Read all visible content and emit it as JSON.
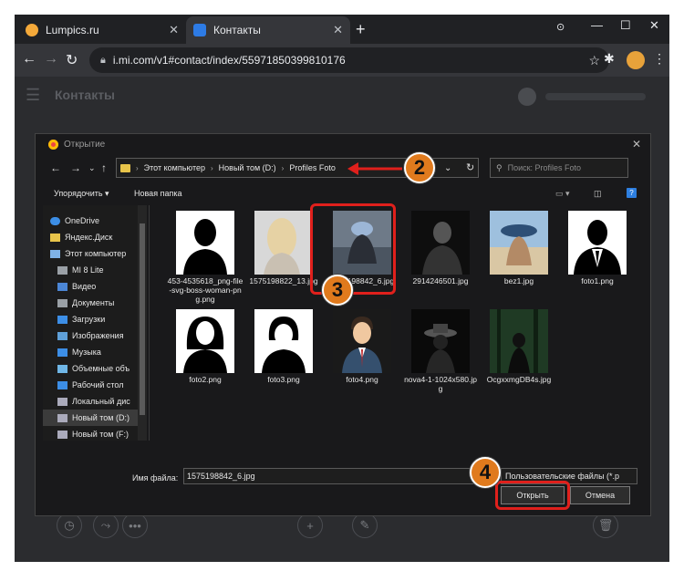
{
  "browser": {
    "tabs": [
      {
        "label": "Lumpics.ru",
        "favicon_color": "#f4a93a"
      },
      {
        "label": "Контакты",
        "favicon_color": "#2d7be5"
      }
    ],
    "url": "i.mi.com/v1#contact/index/55971850399810176"
  },
  "page": {
    "title": "Контакты"
  },
  "dialog": {
    "title": "Открытие",
    "breadcrumb": [
      "Этот компьютер",
      "Новый том (D:)",
      "Profiles Foto"
    ],
    "search_placeholder": "Поиск: Profiles Foto",
    "organize_label": "Упорядочить ▾",
    "new_folder_label": "Новая папка",
    "nav_items": [
      {
        "label": "OneDrive",
        "icon": "cloud-icon",
        "color": "#3c8ee6"
      },
      {
        "label": "Яндекс.Диск",
        "icon": "folder-icon",
        "color": "#e8c44a"
      },
      {
        "label": "Этот компьютер",
        "icon": "computer-icon",
        "color": "#7fb2e6"
      },
      {
        "label": "MI 8 Lite",
        "icon": "phone-icon",
        "color": "#9aa0a6"
      },
      {
        "label": "Видео",
        "icon": "video-icon",
        "color": "#4b86d6"
      },
      {
        "label": "Документы",
        "icon": "documents-icon",
        "color": "#9aa0a6"
      },
      {
        "label": "Загрузки",
        "icon": "download-icon",
        "color": "#3c8ee6"
      },
      {
        "label": "Изображения",
        "icon": "pictures-icon",
        "color": "#5fa0d8"
      },
      {
        "label": "Музыка",
        "icon": "music-icon",
        "color": "#3c8ee6"
      },
      {
        "label": "Объемные объ",
        "icon": "3d-objects-icon",
        "color": "#6fb6e6"
      },
      {
        "label": "Рабочий стол",
        "icon": "desktop-icon",
        "color": "#3c8ee6"
      },
      {
        "label": "Локальный дис",
        "icon": "drive-icon",
        "color": "#aab"
      },
      {
        "label": "Новый том (D:)",
        "icon": "drive-icon",
        "color": "#aab",
        "selected": true
      },
      {
        "label": "Новый том (F:)",
        "icon": "drive-icon",
        "color": "#aab"
      }
    ],
    "files": [
      {
        "name": "453-4535618_png-file-svg-boss-woman-png.png",
        "kind": "silhouette-woman",
        "bg": "#ffffff"
      },
      {
        "name": "1575198822_13.jpg",
        "kind": "photo-blonde",
        "bg": "#cfcfcf"
      },
      {
        "name": "1575198842_6.jpg",
        "kind": "photo-cap",
        "bg": "#6b7785",
        "selected": true
      },
      {
        "name": "2914246501.jpg",
        "kind": "photo-dark-man",
        "bg": "#111111"
      },
      {
        "name": "bez1.jpg",
        "kind": "photo-beach-hat",
        "bg": "#8fb0d0"
      },
      {
        "name": "foto1.png",
        "kind": "silhouette-man-suit",
        "bg": "#ffffff"
      },
      {
        "name": "foto2.png",
        "kind": "silhouette-woman-hair",
        "bg": "#ffffff"
      },
      {
        "name": "foto3.png",
        "kind": "silhouette-woman-short",
        "bg": "#ffffff"
      },
      {
        "name": "foto4.png",
        "kind": "avatar-man-tie",
        "bg": "#1a1a1a"
      },
      {
        "name": "nova4-1-1024x580.jpg",
        "kind": "photo-hat-man",
        "bg": "#0d0d0d"
      },
      {
        "name": "OcgxxmgDB4s.jpg",
        "kind": "photo-forest",
        "bg": "#1d3a22"
      }
    ],
    "filename_label": "Имя файла:",
    "filename_value": "1575198842_6.jpg",
    "filetype_value": "Пользовательские файлы (*.p",
    "open_label": "Открыть",
    "cancel_label": "Отмена"
  },
  "annotations": {
    "steps": [
      "2",
      "3",
      "4"
    ],
    "color": "#e0201c",
    "badge_color": "#e07a1d"
  }
}
